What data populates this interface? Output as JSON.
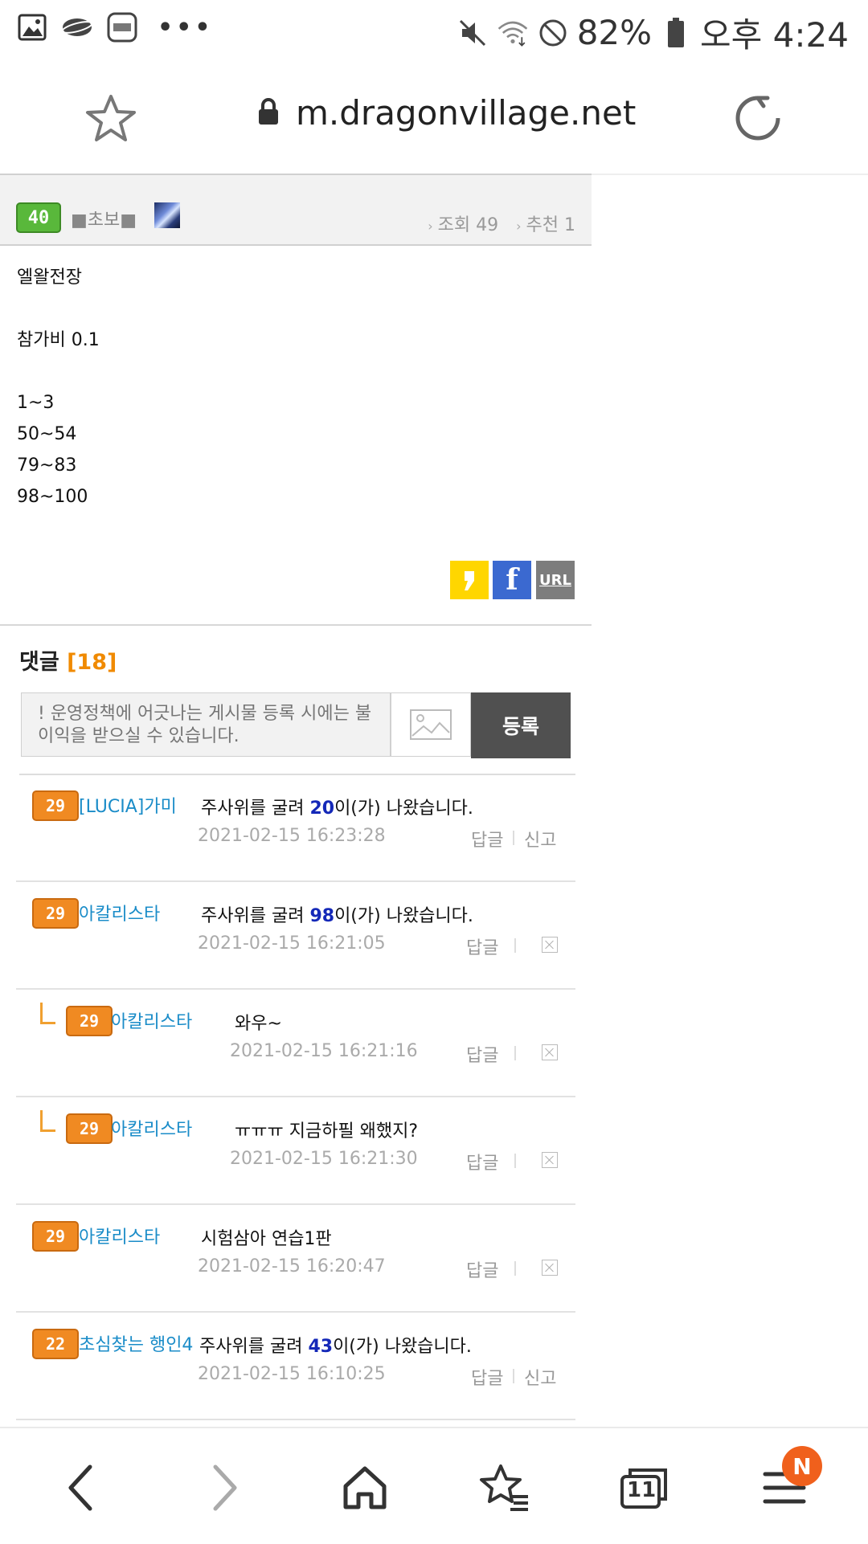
{
  "status_bar": {
    "battery": "82%",
    "time": "오후 4:24",
    "icons": [
      "gallery-icon",
      "planet-icon",
      "app-icon",
      "more-icon",
      "mute-icon",
      "wifi-icon",
      "block-icon",
      "battery-icon"
    ]
  },
  "browser": {
    "url": "m.dragonvillage.net"
  },
  "post": {
    "author_level": "40",
    "author_name": "■초보■",
    "views_label": "조회 49",
    "recommend_label": "추천 1",
    "lines": [
      "엘왈전장",
      "",
      "참가비 0.1",
      "",
      "1~3",
      "50~54",
      "79~83",
      "98~100"
    ],
    "share": {
      "url_label": "URL"
    }
  },
  "comments": {
    "title": "댓글",
    "count": "[18]",
    "placeholder": "! 운영정책에 어긋나는 게시물 등록 시에는 불이익을 받으실 수 있습니다.",
    "submit_label": "등록",
    "reply_label": "답글",
    "report_label": "신고",
    "items": [
      {
        "level": "29",
        "nick": "[LUCIA]가미",
        "text_pre": "주사위를 굴려 ",
        "num": "20",
        "text_post": "이(가) 나왔습니다.",
        "date": "2021-02-15 16:23:28"
      },
      {
        "level": "29",
        "nick": "아칼리스타",
        "text_pre": "주사위를 굴려 ",
        "num": "98",
        "text_post": "이(가) 나왔습니다.",
        "date": "2021-02-15 16:21:05"
      },
      {
        "level": "29",
        "nick": "아칼리스타",
        "text": "와우~",
        "date": "2021-02-15 16:21:16"
      },
      {
        "level": "29",
        "nick": "아칼리스타",
        "text": "ㅠㅠㅠ 지금하필 왜했지?",
        "date": "2021-02-15 16:21:30"
      },
      {
        "level": "29",
        "nick": "아칼리스타",
        "text": "시험삼아 연습1판",
        "date": "2021-02-15 16:20:47"
      },
      {
        "level": "22",
        "nick": "초심찾는 행인4",
        "text_pre": "주사위를 굴려 ",
        "num": "43",
        "text_post": "이(가) 나왔습니다.",
        "date": "2021-02-15 16:10:25"
      }
    ]
  },
  "bottom_bar": {
    "tab_count": "11",
    "notification_badge": "N"
  }
}
